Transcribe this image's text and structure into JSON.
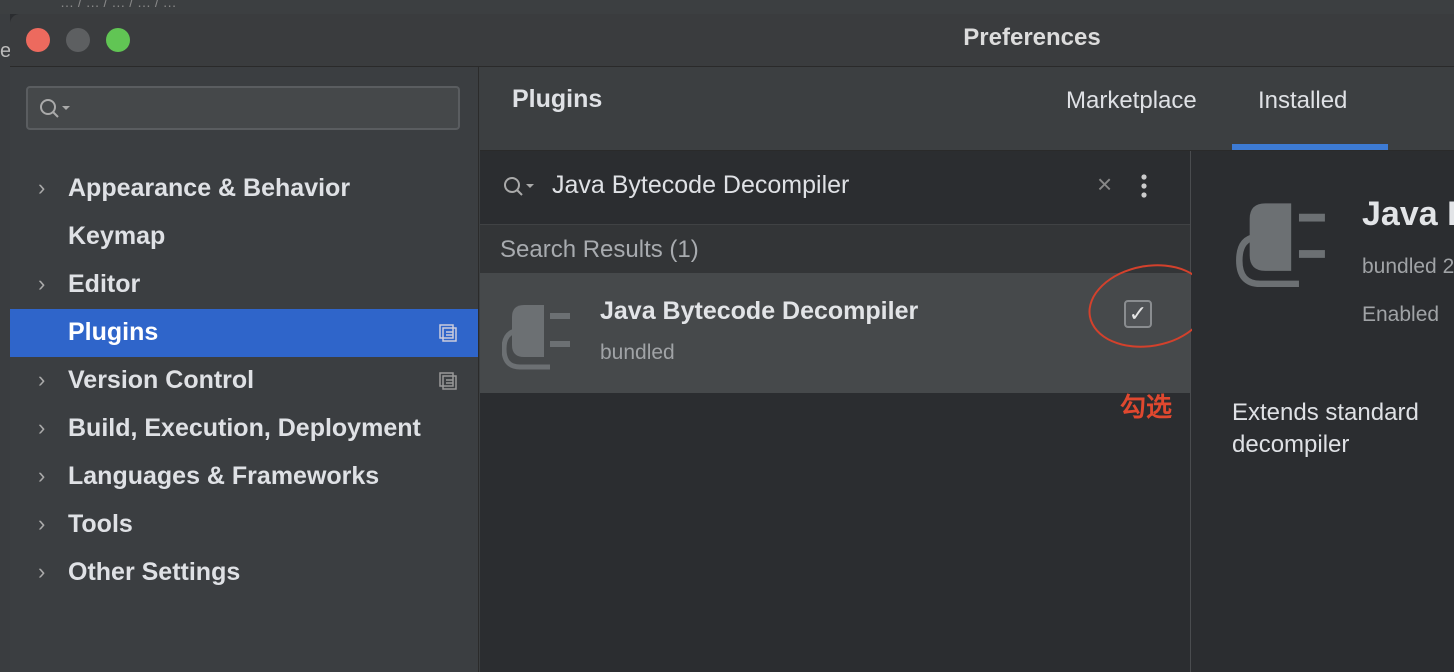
{
  "background_strip": {
    "text": "…  /  …  /  …  /  …  /  …"
  },
  "left_edge": {
    "letter": "e"
  },
  "window": {
    "title": "Preferences"
  },
  "sidebar": {
    "search_placeholder": "",
    "items": [
      {
        "label": "Appearance & Behavior",
        "has_chevron": true,
        "selected": false
      },
      {
        "label": "Keymap",
        "has_chevron": false,
        "selected": false
      },
      {
        "label": "Editor",
        "has_chevron": true,
        "selected": false
      },
      {
        "label": "Plugins",
        "has_chevron": false,
        "selected": true
      },
      {
        "label": "Version Control",
        "has_chevron": true,
        "selected": false
      },
      {
        "label": "Build, Execution, Deployment",
        "has_chevron": true,
        "selected": false
      },
      {
        "label": "Languages & Frameworks",
        "has_chevron": true,
        "selected": false
      },
      {
        "label": "Tools",
        "has_chevron": true,
        "selected": false
      },
      {
        "label": "Other Settings",
        "has_chevron": true,
        "selected": false
      }
    ]
  },
  "plugins": {
    "title": "Plugins",
    "tabs": [
      {
        "label": "Marketplace",
        "active": false
      },
      {
        "label": "Installed",
        "active": true
      }
    ],
    "search_query": "Java Bytecode Decompiler",
    "results_header": "Search Results (1)",
    "result": {
      "name": "Java Bytecode Decompiler",
      "subtitle": "bundled",
      "enabled": true,
      "checkbox_glyph": "✓"
    },
    "annotation": {
      "text": "勾选",
      "color": "#d3412c"
    }
  },
  "detail": {
    "name": "Java Bytecode Decompiler",
    "version": "bundled 2",
    "status": "Enabled",
    "description": "Extends standard decompiler"
  },
  "colors": {
    "selection": "#2f65ca",
    "tab_underline": "#3d7bd4",
    "annotation": "#e0482f"
  }
}
